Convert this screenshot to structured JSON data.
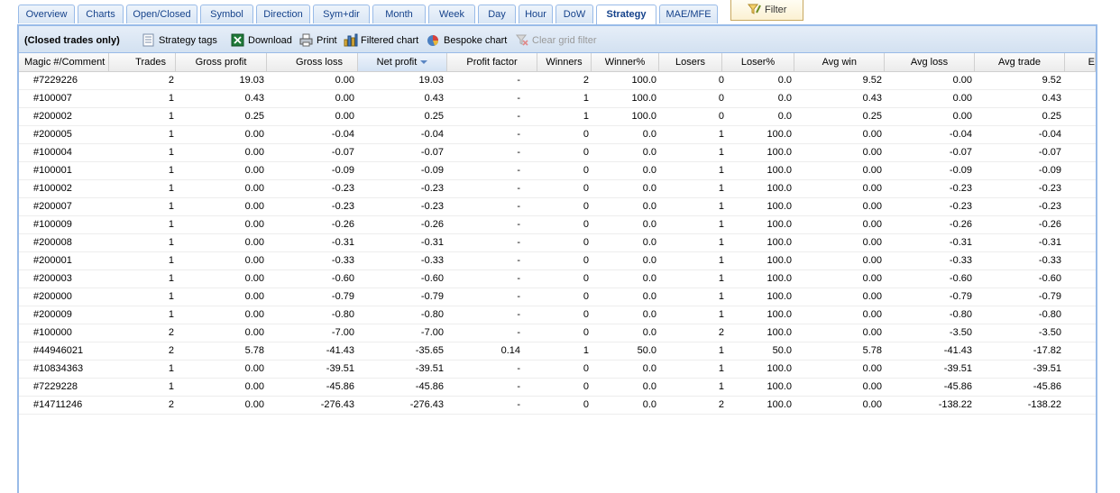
{
  "tabs": [
    {
      "label": "Overview"
    },
    {
      "label": "Charts"
    },
    {
      "label": "Open/Closed"
    },
    {
      "label": "Symbol"
    },
    {
      "label": "Direction"
    },
    {
      "label": "Sym+dir"
    },
    {
      "label": "Month"
    },
    {
      "label": "Week"
    },
    {
      "label": "Day"
    },
    {
      "label": "Hour"
    },
    {
      "label": "DoW"
    },
    {
      "label": "Strategy"
    },
    {
      "label": "MAE/MFE"
    }
  ],
  "active_tab": "Strategy",
  "filter_label": "Filter",
  "toolbar": {
    "status": "(Closed trades only)",
    "strategy_tags": "Strategy tags",
    "download": "Download",
    "print": "Print",
    "filtered_chart": "Filtered chart",
    "bespoke_chart": "Bespoke chart",
    "clear_filter": "Clear grid filter"
  },
  "columns": [
    "Magic #/Comment",
    "Trades",
    "Gross profit",
    "Gross loss",
    "Net profit",
    "Profit factor",
    "Winners",
    "Winner%",
    "Losers",
    "Loser%",
    "Avg win",
    "Avg loss",
    "Avg trade",
    "E"
  ],
  "sorted_column": "Net profit",
  "rows": [
    [
      "#7229226",
      "2",
      "19.03",
      "0.00",
      "19.03",
      "-",
      "2",
      "100.0",
      "0",
      "0.0",
      "9.52",
      "0.00",
      "9.52"
    ],
    [
      "#100007",
      "1",
      "0.43",
      "0.00",
      "0.43",
      "-",
      "1",
      "100.0",
      "0",
      "0.0",
      "0.43",
      "0.00",
      "0.43"
    ],
    [
      "#200002",
      "1",
      "0.25",
      "0.00",
      "0.25",
      "-",
      "1",
      "100.0",
      "0",
      "0.0",
      "0.25",
      "0.00",
      "0.25"
    ],
    [
      "#200005",
      "1",
      "0.00",
      "-0.04",
      "-0.04",
      "-",
      "0",
      "0.0",
      "1",
      "100.0",
      "0.00",
      "-0.04",
      "-0.04"
    ],
    [
      "#100004",
      "1",
      "0.00",
      "-0.07",
      "-0.07",
      "-",
      "0",
      "0.0",
      "1",
      "100.0",
      "0.00",
      "-0.07",
      "-0.07"
    ],
    [
      "#100001",
      "1",
      "0.00",
      "-0.09",
      "-0.09",
      "-",
      "0",
      "0.0",
      "1",
      "100.0",
      "0.00",
      "-0.09",
      "-0.09"
    ],
    [
      "#100002",
      "1",
      "0.00",
      "-0.23",
      "-0.23",
      "-",
      "0",
      "0.0",
      "1",
      "100.0",
      "0.00",
      "-0.23",
      "-0.23"
    ],
    [
      "#200007",
      "1",
      "0.00",
      "-0.23",
      "-0.23",
      "-",
      "0",
      "0.0",
      "1",
      "100.0",
      "0.00",
      "-0.23",
      "-0.23"
    ],
    [
      "#100009",
      "1",
      "0.00",
      "-0.26",
      "-0.26",
      "-",
      "0",
      "0.0",
      "1",
      "100.0",
      "0.00",
      "-0.26",
      "-0.26"
    ],
    [
      "#200008",
      "1",
      "0.00",
      "-0.31",
      "-0.31",
      "-",
      "0",
      "0.0",
      "1",
      "100.0",
      "0.00",
      "-0.31",
      "-0.31"
    ],
    [
      "#200001",
      "1",
      "0.00",
      "-0.33",
      "-0.33",
      "-",
      "0",
      "0.0",
      "1",
      "100.0",
      "0.00",
      "-0.33",
      "-0.33"
    ],
    [
      "#200003",
      "1",
      "0.00",
      "-0.60",
      "-0.60",
      "-",
      "0",
      "0.0",
      "1",
      "100.0",
      "0.00",
      "-0.60",
      "-0.60"
    ],
    [
      "#200000",
      "1",
      "0.00",
      "-0.79",
      "-0.79",
      "-",
      "0",
      "0.0",
      "1",
      "100.0",
      "0.00",
      "-0.79",
      "-0.79"
    ],
    [
      "#200009",
      "1",
      "0.00",
      "-0.80",
      "-0.80",
      "-",
      "0",
      "0.0",
      "1",
      "100.0",
      "0.00",
      "-0.80",
      "-0.80"
    ],
    [
      "#100000",
      "2",
      "0.00",
      "-7.00",
      "-7.00",
      "-",
      "0",
      "0.0",
      "2",
      "100.0",
      "0.00",
      "-3.50",
      "-3.50"
    ],
    [
      "#44946021",
      "2",
      "5.78",
      "-41.43",
      "-35.65",
      "0.14",
      "1",
      "50.0",
      "1",
      "50.0",
      "5.78",
      "-41.43",
      "-17.82"
    ],
    [
      "#10834363",
      "1",
      "0.00",
      "-39.51",
      "-39.51",
      "-",
      "0",
      "0.0",
      "1",
      "100.0",
      "0.00",
      "-39.51",
      "-39.51"
    ],
    [
      "#7229228",
      "1",
      "0.00",
      "-45.86",
      "-45.86",
      "-",
      "0",
      "0.0",
      "1",
      "100.0",
      "0.00",
      "-45.86",
      "-45.86"
    ],
    [
      "#14711246",
      "2",
      "0.00",
      "-276.43",
      "-276.43",
      "-",
      "0",
      "0.0",
      "2",
      "100.0",
      "0.00",
      "-138.22",
      "-138.22"
    ]
  ],
  "colors": {
    "tab_text": "#15428b",
    "panel_border": "#99bbe8",
    "sort_arrow": "#5a86c3"
  }
}
